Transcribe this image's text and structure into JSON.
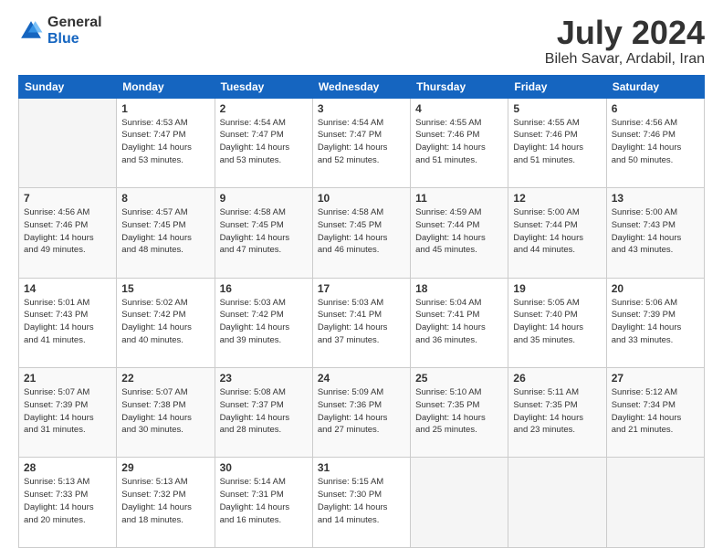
{
  "header": {
    "logo_general": "General",
    "logo_blue": "Blue",
    "month_title": "July 2024",
    "location": "Bileh Savar, Ardabil, Iran"
  },
  "weekdays": [
    "Sunday",
    "Monday",
    "Tuesday",
    "Wednesday",
    "Thursday",
    "Friday",
    "Saturday"
  ],
  "weeks": [
    [
      {
        "day": "",
        "info": ""
      },
      {
        "day": "1",
        "info": "Sunrise: 4:53 AM\nSunset: 7:47 PM\nDaylight: 14 hours\nand 53 minutes."
      },
      {
        "day": "2",
        "info": "Sunrise: 4:54 AM\nSunset: 7:47 PM\nDaylight: 14 hours\nand 53 minutes."
      },
      {
        "day": "3",
        "info": "Sunrise: 4:54 AM\nSunset: 7:47 PM\nDaylight: 14 hours\nand 52 minutes."
      },
      {
        "day": "4",
        "info": "Sunrise: 4:55 AM\nSunset: 7:46 PM\nDaylight: 14 hours\nand 51 minutes."
      },
      {
        "day": "5",
        "info": "Sunrise: 4:55 AM\nSunset: 7:46 PM\nDaylight: 14 hours\nand 51 minutes."
      },
      {
        "day": "6",
        "info": "Sunrise: 4:56 AM\nSunset: 7:46 PM\nDaylight: 14 hours\nand 50 minutes."
      }
    ],
    [
      {
        "day": "7",
        "info": "Sunrise: 4:56 AM\nSunset: 7:46 PM\nDaylight: 14 hours\nand 49 minutes."
      },
      {
        "day": "8",
        "info": "Sunrise: 4:57 AM\nSunset: 7:45 PM\nDaylight: 14 hours\nand 48 minutes."
      },
      {
        "day": "9",
        "info": "Sunrise: 4:58 AM\nSunset: 7:45 PM\nDaylight: 14 hours\nand 47 minutes."
      },
      {
        "day": "10",
        "info": "Sunrise: 4:58 AM\nSunset: 7:45 PM\nDaylight: 14 hours\nand 46 minutes."
      },
      {
        "day": "11",
        "info": "Sunrise: 4:59 AM\nSunset: 7:44 PM\nDaylight: 14 hours\nand 45 minutes."
      },
      {
        "day": "12",
        "info": "Sunrise: 5:00 AM\nSunset: 7:44 PM\nDaylight: 14 hours\nand 44 minutes."
      },
      {
        "day": "13",
        "info": "Sunrise: 5:00 AM\nSunset: 7:43 PM\nDaylight: 14 hours\nand 43 minutes."
      }
    ],
    [
      {
        "day": "14",
        "info": "Sunrise: 5:01 AM\nSunset: 7:43 PM\nDaylight: 14 hours\nand 41 minutes."
      },
      {
        "day": "15",
        "info": "Sunrise: 5:02 AM\nSunset: 7:42 PM\nDaylight: 14 hours\nand 40 minutes."
      },
      {
        "day": "16",
        "info": "Sunrise: 5:03 AM\nSunset: 7:42 PM\nDaylight: 14 hours\nand 39 minutes."
      },
      {
        "day": "17",
        "info": "Sunrise: 5:03 AM\nSunset: 7:41 PM\nDaylight: 14 hours\nand 37 minutes."
      },
      {
        "day": "18",
        "info": "Sunrise: 5:04 AM\nSunset: 7:41 PM\nDaylight: 14 hours\nand 36 minutes."
      },
      {
        "day": "19",
        "info": "Sunrise: 5:05 AM\nSunset: 7:40 PM\nDaylight: 14 hours\nand 35 minutes."
      },
      {
        "day": "20",
        "info": "Sunrise: 5:06 AM\nSunset: 7:39 PM\nDaylight: 14 hours\nand 33 minutes."
      }
    ],
    [
      {
        "day": "21",
        "info": "Sunrise: 5:07 AM\nSunset: 7:39 PM\nDaylight: 14 hours\nand 31 minutes."
      },
      {
        "day": "22",
        "info": "Sunrise: 5:07 AM\nSunset: 7:38 PM\nDaylight: 14 hours\nand 30 minutes."
      },
      {
        "day": "23",
        "info": "Sunrise: 5:08 AM\nSunset: 7:37 PM\nDaylight: 14 hours\nand 28 minutes."
      },
      {
        "day": "24",
        "info": "Sunrise: 5:09 AM\nSunset: 7:36 PM\nDaylight: 14 hours\nand 27 minutes."
      },
      {
        "day": "25",
        "info": "Sunrise: 5:10 AM\nSunset: 7:35 PM\nDaylight: 14 hours\nand 25 minutes."
      },
      {
        "day": "26",
        "info": "Sunrise: 5:11 AM\nSunset: 7:35 PM\nDaylight: 14 hours\nand 23 minutes."
      },
      {
        "day": "27",
        "info": "Sunrise: 5:12 AM\nSunset: 7:34 PM\nDaylight: 14 hours\nand 21 minutes."
      }
    ],
    [
      {
        "day": "28",
        "info": "Sunrise: 5:13 AM\nSunset: 7:33 PM\nDaylight: 14 hours\nand 20 minutes."
      },
      {
        "day": "29",
        "info": "Sunrise: 5:13 AM\nSunset: 7:32 PM\nDaylight: 14 hours\nand 18 minutes."
      },
      {
        "day": "30",
        "info": "Sunrise: 5:14 AM\nSunset: 7:31 PM\nDaylight: 14 hours\nand 16 minutes."
      },
      {
        "day": "31",
        "info": "Sunrise: 5:15 AM\nSunset: 7:30 PM\nDaylight: 14 hours\nand 14 minutes."
      },
      {
        "day": "",
        "info": ""
      },
      {
        "day": "",
        "info": ""
      },
      {
        "day": "",
        "info": ""
      }
    ]
  ]
}
